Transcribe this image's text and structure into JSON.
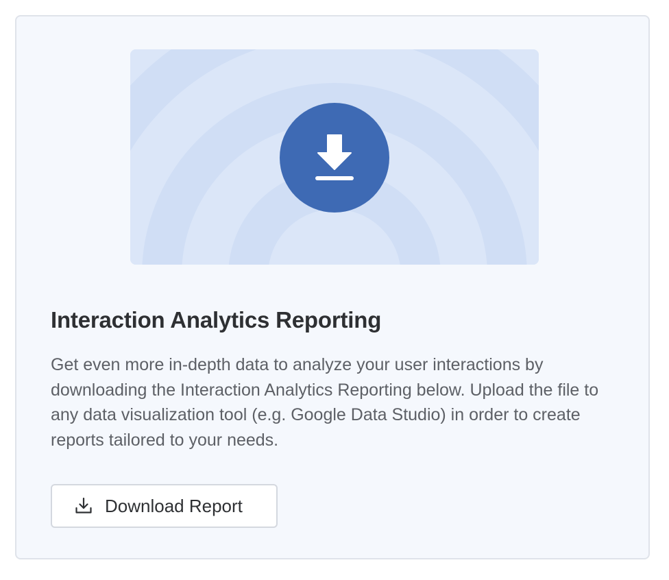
{
  "card": {
    "title": "Interaction Analytics Reporting",
    "description": "Get even more in-depth data to analyze your user interactions by downloading the Interaction Analytics Reporting below. Upload the file to any data visualization tool (e.g. Google Data Studio) in order to create reports tailored to your needs.",
    "hero_icon": "download-icon",
    "button": {
      "label": "Download Report",
      "icon": "download-icon"
    }
  },
  "colors": {
    "card_background": "#f5f8fd",
    "hero_background": "#dbe6f8",
    "hero_rings": "#d0def5",
    "accent": "#3e6ab4",
    "title_text": "#2e3033",
    "body_text": "#5d6066"
  }
}
